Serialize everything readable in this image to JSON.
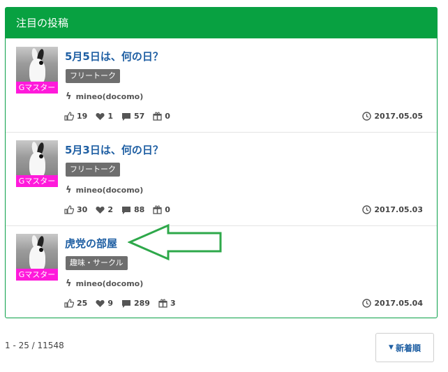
{
  "panel": {
    "title": "注目の投稿"
  },
  "posts": [
    {
      "badge": "Gマスター",
      "title": "5月5日は、何の日？",
      "tag": "フリートーク",
      "carrier": "mineo(docomo)",
      "likes": "19",
      "hearts": "1",
      "comments": "57",
      "gifts": "0",
      "date": "2017.05.05"
    },
    {
      "badge": "Gマスター",
      "title": "5月3日は、何の日？",
      "tag": "フリートーク",
      "carrier": "mineo(docomo)",
      "likes": "30",
      "hearts": "2",
      "comments": "88",
      "gifts": "0",
      "date": "2017.05.03"
    },
    {
      "badge": "Gマスター",
      "title": "虎党の部屋",
      "tag": "趣味・サークル",
      "carrier": "mineo(docomo)",
      "likes": "25",
      "hearts": "9",
      "comments": "289",
      "gifts": "3",
      "date": "2017.05.04"
    }
  ],
  "pagination": {
    "info": "1 - 25 / 11548",
    "sort_label": "新着順"
  },
  "colors": {
    "header": "#08a141",
    "link": "#1f5fa3",
    "badge": "#ff1adb",
    "arrow": "#2ea84a"
  },
  "icons": [
    "thumbs-up-icon",
    "heart-icon",
    "comment-icon",
    "gift-icon",
    "clock-icon",
    "bolt-icon",
    "caret-down-icon"
  ]
}
